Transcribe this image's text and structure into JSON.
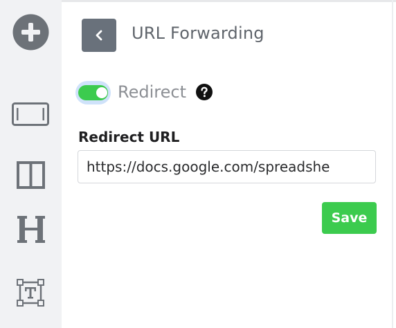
{
  "header": {
    "title": "URL Forwarding",
    "back_icon": "chevron-left-icon"
  },
  "redirect": {
    "label": "Redirect",
    "enabled": true,
    "help_icon": "question-circle-icon"
  },
  "url_field": {
    "label": "Redirect URL",
    "value": "https://docs.google.com/spreadshe"
  },
  "actions": {
    "save_label": "Save"
  },
  "sidebar": {
    "icons": [
      "add-circle-icon",
      "button-block-icon",
      "columns-icon",
      "heading-icon",
      "text-block-icon"
    ]
  },
  "colors": {
    "accent_green": "#3ccb4e",
    "back_button": "#69717b",
    "sidebar_bg": "#f1f2f4"
  }
}
